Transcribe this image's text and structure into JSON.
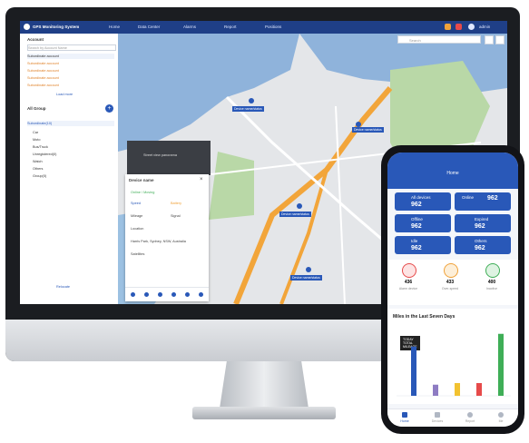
{
  "app": {
    "title": "GPS Monitoring System",
    "nav": [
      "Home",
      "Data Center",
      "Alarms",
      "Report",
      "Positions"
    ],
    "user": "admin"
  },
  "sidebar": {
    "section_title": "Account",
    "search_placeholder": "Search by Account Name",
    "accounts": [
      "Subordinate account",
      "Subordinate account",
      "Subordinate account",
      "Subordinate account",
      "Subordinate account"
    ],
    "load_more": "Load more",
    "group_title": "All Group",
    "tree_root": "Subordinate(10)",
    "devices": [
      "Car",
      "Moto",
      "Bus/Truck",
      "Unregistered(0)",
      "Watch",
      "Others",
      "Group(0)"
    ],
    "footer_link": "Relocate"
  },
  "map": {
    "search_placeholder": "Search",
    "labels": [
      "Device name/status",
      "Device name/status",
      "Device name/status",
      "Device name/status"
    ],
    "streetview": "Street view panorama"
  },
  "popup": {
    "title": "Device name",
    "status": "Online / Moving",
    "fields": [
      "Speed",
      "Battery",
      "Mileage",
      "Signal",
      "Location",
      "Satellites"
    ],
    "address": "Harris Park, Sydney, NSW, Australia",
    "buttons": [
      "Playback",
      "Track",
      "Geofence",
      "Command",
      "Details",
      "More"
    ]
  },
  "phone": {
    "header": "Home",
    "stats": [
      {
        "label": "All devices",
        "value": "962"
      },
      {
        "label": "Online",
        "value": "962"
      },
      {
        "label": "Offline",
        "value": "962"
      },
      {
        "label": "Expired",
        "value": "962"
      },
      {
        "label": "Idle",
        "value": "962"
      },
      {
        "label": "Others",
        "value": "962"
      }
    ],
    "summary": [
      {
        "value": "436",
        "label": "Alarm device"
      },
      {
        "value": "433",
        "label": "Over-speed"
      },
      {
        "value": "400",
        "label": "Inactive"
      }
    ],
    "chart_title": "Miles in the Last Seven Days",
    "tooltip": [
      "TODAY",
      "TOTAL",
      "MILEAGE"
    ],
    "tabs": [
      "Home",
      "Devices",
      "Report",
      "Me"
    ]
  },
  "colors": {
    "primary": "#1f3f87",
    "accent": "#2958b8",
    "alert_red": "#e64a4a",
    "orange": "#f0a23a",
    "green": "#3fae57"
  },
  "chart_data": {
    "type": "bar",
    "title": "Miles in the Last Seven Days",
    "categories": [
      "1",
      "2",
      "3",
      "4",
      "5"
    ],
    "series": [
      {
        "values": [
          62,
          14,
          16,
          16,
          78
        ]
      }
    ]
  }
}
